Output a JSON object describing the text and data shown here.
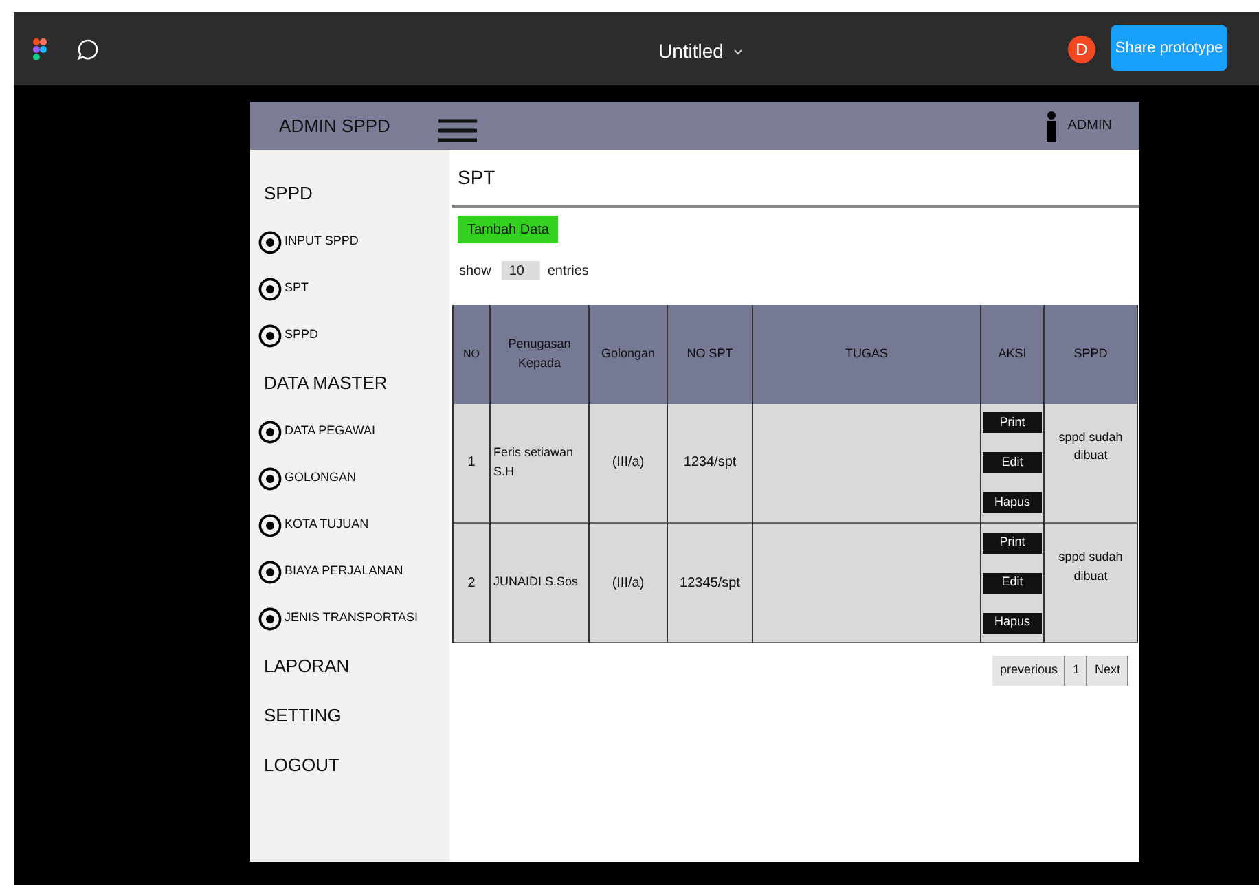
{
  "editor": {
    "title": "Untitled",
    "avatar": "D",
    "share_button": "Share prototype"
  },
  "app": {
    "brand": "ADMIN SPPD",
    "user": "ADMIN",
    "sidebar": [
      {
        "kind": "section",
        "label": "SPPD"
      },
      {
        "kind": "link",
        "label": "INPUT SPPD"
      },
      {
        "kind": "link",
        "label": "SPT"
      },
      {
        "kind": "link",
        "label": "SPPD"
      },
      {
        "kind": "section",
        "label": "DATA MASTER"
      },
      {
        "kind": "link",
        "label": "DATA PEGAWAI"
      },
      {
        "kind": "link",
        "label": "GOLONGAN"
      },
      {
        "kind": "link",
        "label": "KOTA TUJUAN"
      },
      {
        "kind": "link",
        "label": "BIAYA PERJALANAN"
      },
      {
        "kind": "link",
        "label": "JENIS TRANSPORTASI"
      },
      {
        "kind": "section",
        "label": "LAPORAN"
      },
      {
        "kind": "section",
        "label": "SETTING"
      },
      {
        "kind": "section",
        "label": "LOGOUT"
      }
    ],
    "page_title": "SPT",
    "add_button": "Tambah Data",
    "show_label": "show",
    "entries_value": "10",
    "entries_label": "entries",
    "table": {
      "columns": [
        "NO",
        "Penugasan Kepada",
        "Golongan",
        "NO SPT",
        "TUGAS",
        "AKSI",
        "SPPD"
      ],
      "rows": [
        {
          "no": "1",
          "name": "Feris setiawan S.H",
          "golongan": "(III/a)",
          "no_spt": "1234/spt",
          "actions": [
            "Print",
            "Edit",
            "Hapus"
          ],
          "sppd": "sppd sudah dibuat"
        },
        {
          "no": "2",
          "name": "JUNAIDI S.Sos",
          "golongan": "(III/a)",
          "no_spt": "12345/spt",
          "actions": [
            "Print",
            "Edit",
            "Hapus"
          ],
          "sppd": "sppd sudah dibuat"
        }
      ]
    },
    "pagination": [
      "preverious",
      "1",
      "Next"
    ]
  }
}
